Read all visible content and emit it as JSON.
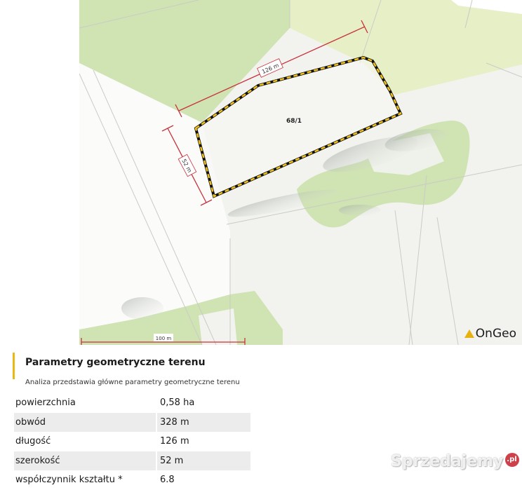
{
  "map": {
    "parcel_label": "68/1",
    "dim_top": "126 m",
    "dim_left": "52 m",
    "scale_bar": "100 m",
    "logo": "OnGeo",
    "colors": {
      "parcel_outline": "#f2c21b",
      "dimension": "#c8323c",
      "vegetation": "#cfe3b3",
      "field": "#f4f5f1"
    }
  },
  "section": {
    "title": "Parametry geometryczne terenu",
    "subtitle": "Analiza przedstawia główne parametry geometryczne terenu"
  },
  "params": [
    {
      "label": "powierzchnia",
      "value": "0,58 ha"
    },
    {
      "label": "obwód",
      "value": "328 m"
    },
    {
      "label": "długość",
      "value": "126 m"
    },
    {
      "label": "szerokość",
      "value": "52 m"
    },
    {
      "label": "współczynnik kształtu *",
      "value": "6.8"
    }
  ],
  "watermark": {
    "text": "Sprzedajemy",
    "badge": ".pl"
  }
}
